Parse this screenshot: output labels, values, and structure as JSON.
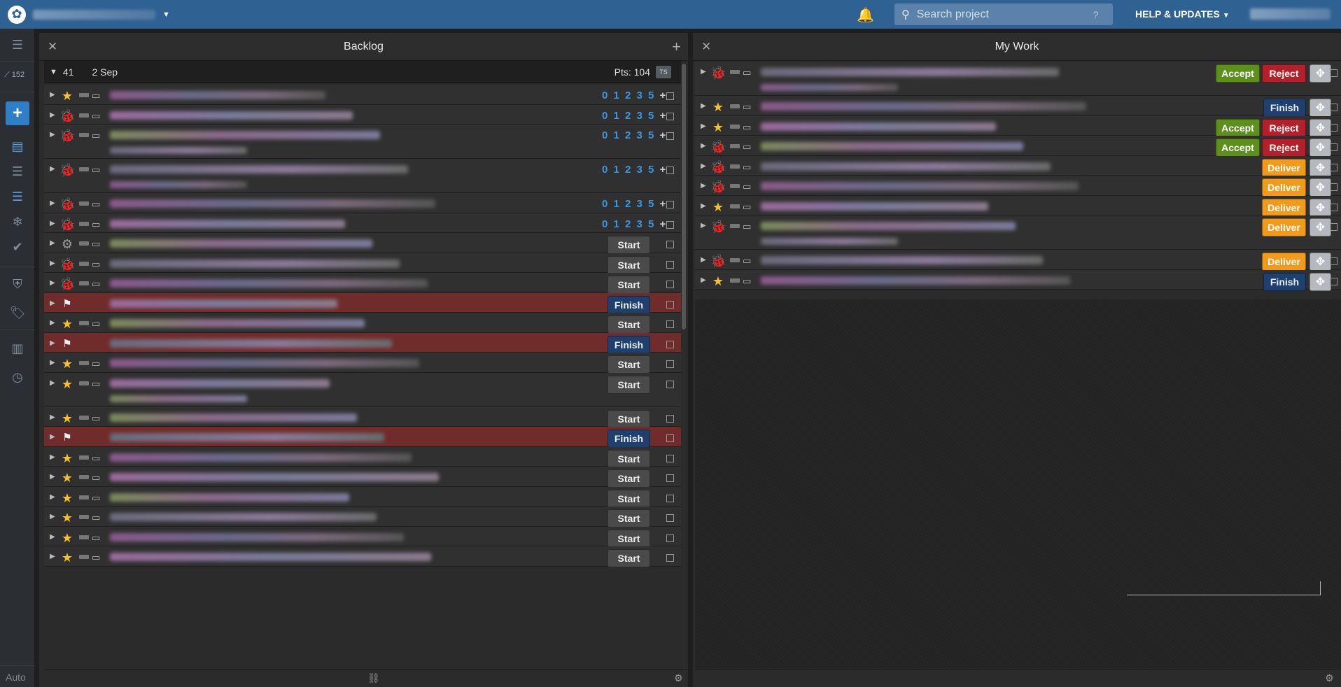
{
  "topbar": {
    "search_placeholder": "Search project",
    "search_help": "?",
    "help_label": "HELP & UPDATES"
  },
  "sidebar": {
    "velocity": "152",
    "auto_label": "Auto"
  },
  "backlog": {
    "title": "Backlog",
    "iteration_number": "41",
    "iteration_date": "2 Sep",
    "points_label": "Pts: 104",
    "ts_label": "TS",
    "estimate_scale": "0 1 2 3 5",
    "estimate_plus": "+",
    "rows": [
      {
        "type": "feature",
        "estimate": true,
        "state": "unestimated",
        "lines": 1
      },
      {
        "type": "bug",
        "estimate": true,
        "state": "unestimated",
        "lines": 1
      },
      {
        "type": "bug",
        "estimate": true,
        "state": "unestimated",
        "lines": 2
      },
      {
        "type": "bug",
        "estimate": true,
        "state": "unestimated",
        "lines": 2
      },
      {
        "type": "bug",
        "estimate": true,
        "state": "unestimated",
        "lines": 1
      },
      {
        "type": "bug",
        "estimate": true,
        "state": "unestimated",
        "lines": 1
      },
      {
        "type": "chore",
        "state": "start",
        "lines": 1
      },
      {
        "type": "bug",
        "state": "start",
        "lines": 1
      },
      {
        "type": "bug",
        "state": "start",
        "lines": 1
      },
      {
        "type": "release",
        "state": "finish",
        "lines": 1
      },
      {
        "type": "feature",
        "state": "start",
        "lines": 1
      },
      {
        "type": "release",
        "state": "finish",
        "lines": 1
      },
      {
        "type": "feature",
        "state": "start",
        "lines": 1
      },
      {
        "type": "feature",
        "state": "start",
        "lines": 2
      },
      {
        "type": "feature",
        "state": "start",
        "lines": 1
      },
      {
        "type": "release",
        "state": "finish",
        "lines": 1
      },
      {
        "type": "feature",
        "state": "start",
        "lines": 1
      },
      {
        "type": "feature",
        "state": "start",
        "lines": 1
      },
      {
        "type": "feature",
        "state": "start",
        "lines": 1
      },
      {
        "type": "feature",
        "state": "start",
        "lines": 1
      },
      {
        "type": "feature",
        "state": "start",
        "lines": 1
      },
      {
        "type": "feature",
        "state": "start",
        "lines": 1
      }
    ],
    "labels": {
      "start": "Start",
      "finish": "Finish"
    }
  },
  "mywork": {
    "title": "My Work",
    "rows": [
      {
        "type": "bug",
        "actions": [
          "accept",
          "reject"
        ],
        "lines": 2
      },
      {
        "type": "feature",
        "actions": [
          "finish"
        ],
        "lines": 1
      },
      {
        "type": "feature",
        "actions": [
          "accept",
          "reject"
        ],
        "lines": 1
      },
      {
        "type": "bug",
        "actions": [
          "accept",
          "reject"
        ],
        "lines": 1
      },
      {
        "type": "bug",
        "actions": [
          "deliver"
        ],
        "lines": 1
      },
      {
        "type": "bug",
        "actions": [
          "deliver"
        ],
        "lines": 1
      },
      {
        "type": "feature",
        "actions": [
          "deliver"
        ],
        "lines": 1
      },
      {
        "type": "bug",
        "actions": [
          "deliver"
        ],
        "lines": 2
      },
      {
        "type": "bug",
        "actions": [
          "deliver"
        ],
        "lines": 1
      },
      {
        "type": "feature",
        "actions": [
          "finish"
        ],
        "lines": 1
      }
    ],
    "labels": {
      "accept": "Accept",
      "reject": "Reject",
      "deliver": "Deliver",
      "finish": "Finish"
    }
  },
  "icons": {
    "feature": "star-icon",
    "bug": "bug-icon",
    "chore": "gear-icon",
    "release": "flag-icon"
  },
  "colors": {
    "topbar": "#2f6192",
    "accept": "#5d8f1c",
    "reject": "#b3202c",
    "deliver": "#f29a1a",
    "finish": "#1f3f6f",
    "release_row": "#702c2a",
    "estimate": "#3e97dd"
  }
}
